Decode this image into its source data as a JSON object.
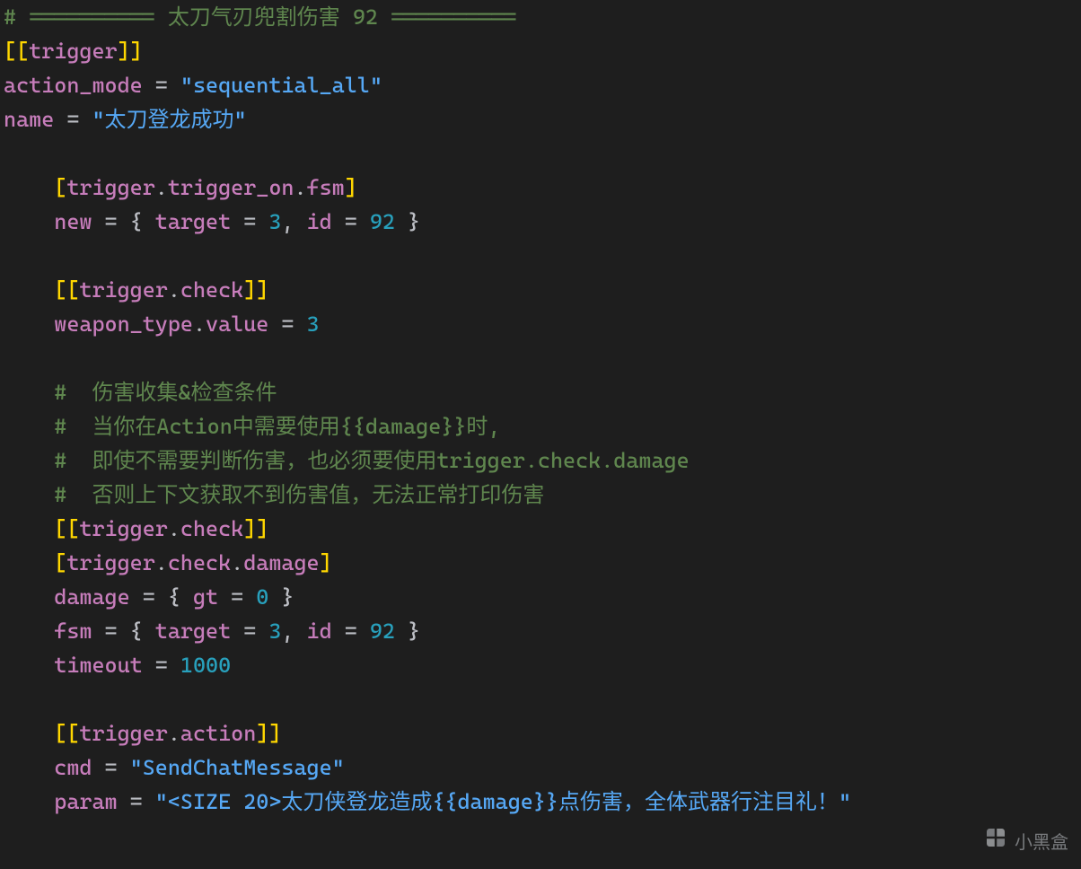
{
  "lines": [
    [
      {
        "cls": "comment",
        "text": "# ========== 太刀气刃兜割伤害 92 =========="
      }
    ],
    [
      {
        "cls": "bracket",
        "text": "[["
      },
      {
        "cls": "key",
        "text": "trigger"
      },
      {
        "cls": "bracket",
        "text": "]]"
      }
    ],
    [
      {
        "cls": "key",
        "text": "action_mode"
      },
      {
        "cls": "op",
        "text": " = "
      },
      {
        "cls": "string",
        "text": "\"sequential_all\""
      }
    ],
    [
      {
        "cls": "key",
        "text": "name"
      },
      {
        "cls": "op",
        "text": " = "
      },
      {
        "cls": "string",
        "text": "\"太刀登龙成功\""
      }
    ],
    [
      {
        "cls": "",
        "text": ""
      }
    ],
    [
      {
        "cls": "",
        "text": "    "
      },
      {
        "cls": "bracket",
        "text": "["
      },
      {
        "cls": "key",
        "text": "trigger"
      },
      {
        "cls": "punct",
        "text": "."
      },
      {
        "cls": "key",
        "text": "trigger_on"
      },
      {
        "cls": "punct",
        "text": "."
      },
      {
        "cls": "key",
        "text": "fsm"
      },
      {
        "cls": "bracket",
        "text": "]"
      }
    ],
    [
      {
        "cls": "",
        "text": "    "
      },
      {
        "cls": "key",
        "text": "new"
      },
      {
        "cls": "op",
        "text": " = "
      },
      {
        "cls": "brace",
        "text": "{ "
      },
      {
        "cls": "key",
        "text": "target"
      },
      {
        "cls": "op",
        "text": " = "
      },
      {
        "cls": "num",
        "text": "3"
      },
      {
        "cls": "punct",
        "text": ", "
      },
      {
        "cls": "key",
        "text": "id"
      },
      {
        "cls": "op",
        "text": " = "
      },
      {
        "cls": "num",
        "text": "92"
      },
      {
        "cls": "brace",
        "text": " }"
      }
    ],
    [
      {
        "cls": "",
        "text": ""
      }
    ],
    [
      {
        "cls": "",
        "text": "    "
      },
      {
        "cls": "bracket",
        "text": "[["
      },
      {
        "cls": "key",
        "text": "trigger"
      },
      {
        "cls": "punct",
        "text": "."
      },
      {
        "cls": "key",
        "text": "check"
      },
      {
        "cls": "bracket",
        "text": "]]"
      }
    ],
    [
      {
        "cls": "",
        "text": "    "
      },
      {
        "cls": "key",
        "text": "weapon_type"
      },
      {
        "cls": "punct",
        "text": "."
      },
      {
        "cls": "key",
        "text": "value"
      },
      {
        "cls": "op",
        "text": " = "
      },
      {
        "cls": "num",
        "text": "3"
      }
    ],
    [
      {
        "cls": "",
        "text": ""
      }
    ],
    [
      {
        "cls": "",
        "text": "    "
      },
      {
        "cls": "comment",
        "text": "#  伤害收集&检查条件"
      }
    ],
    [
      {
        "cls": "",
        "text": "    "
      },
      {
        "cls": "comment",
        "text": "#  当你在Action中需要使用{{damage}}时,"
      }
    ],
    [
      {
        "cls": "",
        "text": "    "
      },
      {
        "cls": "comment",
        "text": "#  即使不需要判断伤害，也必须要使用trigger.check.damage"
      }
    ],
    [
      {
        "cls": "",
        "text": "    "
      },
      {
        "cls": "comment",
        "text": "#  否则上下文获取不到伤害值，无法正常打印伤害"
      }
    ],
    [
      {
        "cls": "",
        "text": "    "
      },
      {
        "cls": "bracket",
        "text": "[["
      },
      {
        "cls": "key",
        "text": "trigger"
      },
      {
        "cls": "punct",
        "text": "."
      },
      {
        "cls": "key",
        "text": "check"
      },
      {
        "cls": "bracket",
        "text": "]]"
      }
    ],
    [
      {
        "cls": "",
        "text": "    "
      },
      {
        "cls": "bracket",
        "text": "["
      },
      {
        "cls": "key",
        "text": "trigger"
      },
      {
        "cls": "punct",
        "text": "."
      },
      {
        "cls": "key",
        "text": "check"
      },
      {
        "cls": "punct",
        "text": "."
      },
      {
        "cls": "key",
        "text": "damage"
      },
      {
        "cls": "bracket",
        "text": "]"
      }
    ],
    [
      {
        "cls": "",
        "text": "    "
      },
      {
        "cls": "key",
        "text": "damage"
      },
      {
        "cls": "op",
        "text": " = "
      },
      {
        "cls": "brace",
        "text": "{ "
      },
      {
        "cls": "key",
        "text": "gt"
      },
      {
        "cls": "op",
        "text": " = "
      },
      {
        "cls": "num",
        "text": "0"
      },
      {
        "cls": "brace",
        "text": " }"
      }
    ],
    [
      {
        "cls": "",
        "text": "    "
      },
      {
        "cls": "key",
        "text": "fsm"
      },
      {
        "cls": "op",
        "text": " = "
      },
      {
        "cls": "brace",
        "text": "{ "
      },
      {
        "cls": "key",
        "text": "target"
      },
      {
        "cls": "op",
        "text": " = "
      },
      {
        "cls": "num",
        "text": "3"
      },
      {
        "cls": "punct",
        "text": ", "
      },
      {
        "cls": "key",
        "text": "id"
      },
      {
        "cls": "op",
        "text": " = "
      },
      {
        "cls": "num",
        "text": "92"
      },
      {
        "cls": "brace",
        "text": " }"
      }
    ],
    [
      {
        "cls": "",
        "text": "    "
      },
      {
        "cls": "key",
        "text": "timeout"
      },
      {
        "cls": "op",
        "text": " = "
      },
      {
        "cls": "num",
        "text": "1000"
      }
    ],
    [
      {
        "cls": "",
        "text": ""
      }
    ],
    [
      {
        "cls": "",
        "text": "    "
      },
      {
        "cls": "bracket",
        "text": "[["
      },
      {
        "cls": "key",
        "text": "trigger"
      },
      {
        "cls": "punct",
        "text": "."
      },
      {
        "cls": "key",
        "text": "action"
      },
      {
        "cls": "bracket",
        "text": "]]"
      }
    ],
    [
      {
        "cls": "",
        "text": "    "
      },
      {
        "cls": "key",
        "text": "cmd"
      },
      {
        "cls": "op",
        "text": " = "
      },
      {
        "cls": "string",
        "text": "\"SendChatMessage\""
      }
    ],
    [
      {
        "cls": "",
        "text": "    "
      },
      {
        "cls": "key",
        "text": "param"
      },
      {
        "cls": "op",
        "text": " = "
      },
      {
        "cls": "string",
        "text": "\"<SIZE 20>太刀侠登龙造成{{damage}}点伤害，全体武器行注目礼！\""
      }
    ]
  ],
  "watermark": {
    "text": "小黑盒"
  }
}
